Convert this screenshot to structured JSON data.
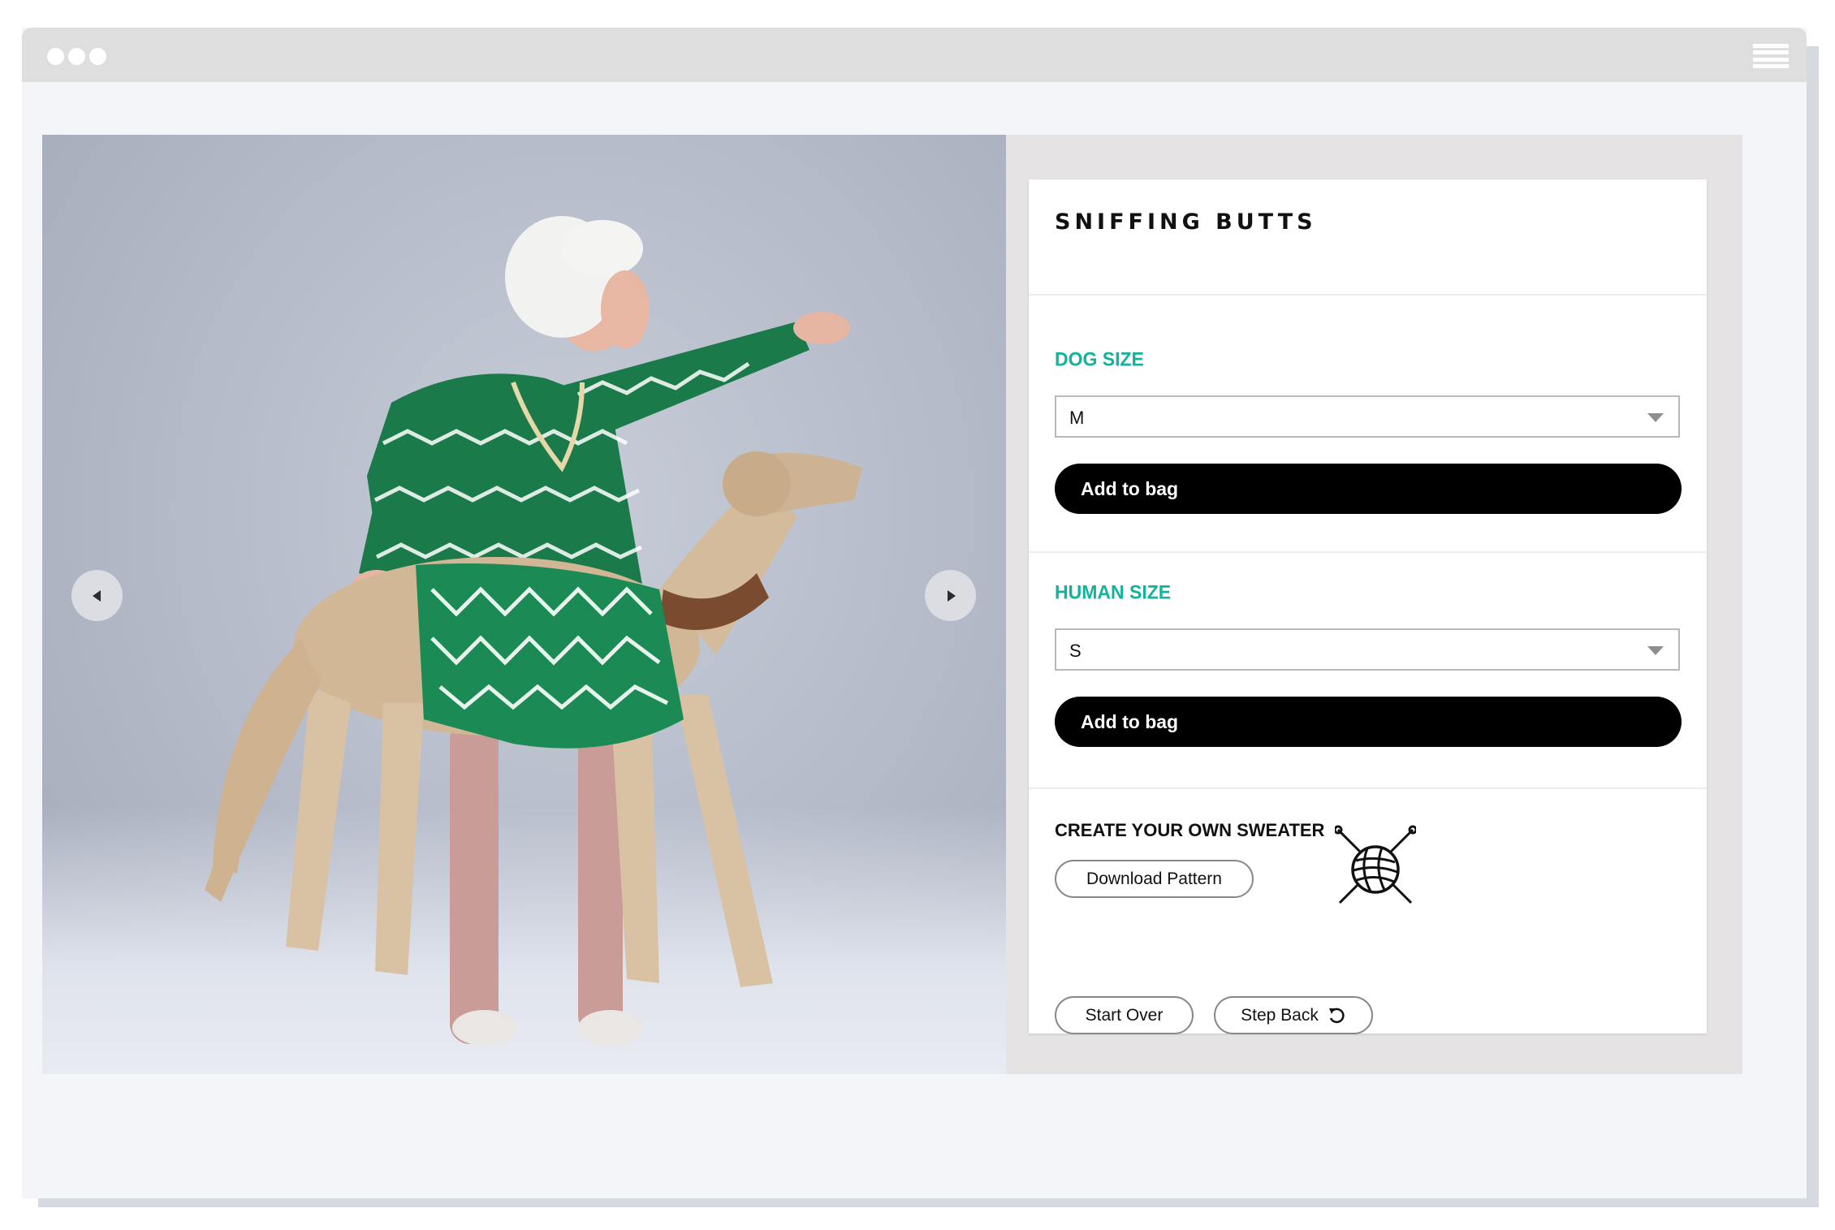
{
  "product": {
    "title": "SNIFFING BUTTS"
  },
  "dog_size": {
    "label": "DOG SIZE",
    "selected": "M",
    "add_label": "Add to bag"
  },
  "human_size": {
    "label": "HUMAN SIZE",
    "selected": "S",
    "add_label": "Add to bag"
  },
  "create": {
    "title": "CREATE YOUR OWN SWEATER",
    "download_label": "Download Pattern",
    "icon": "yarn-ball-knitting-needles-icon"
  },
  "footer": {
    "start_over_label": "Start Over",
    "step_back_label": "Step Back",
    "step_back_icon": "undo-icon"
  },
  "carousel": {
    "prev_icon": "arrow-left-icon",
    "next_icon": "arrow-right-icon"
  },
  "colors": {
    "accent": "#12b39b",
    "button": "#000000",
    "sweater_green": "#1b7a4a"
  }
}
